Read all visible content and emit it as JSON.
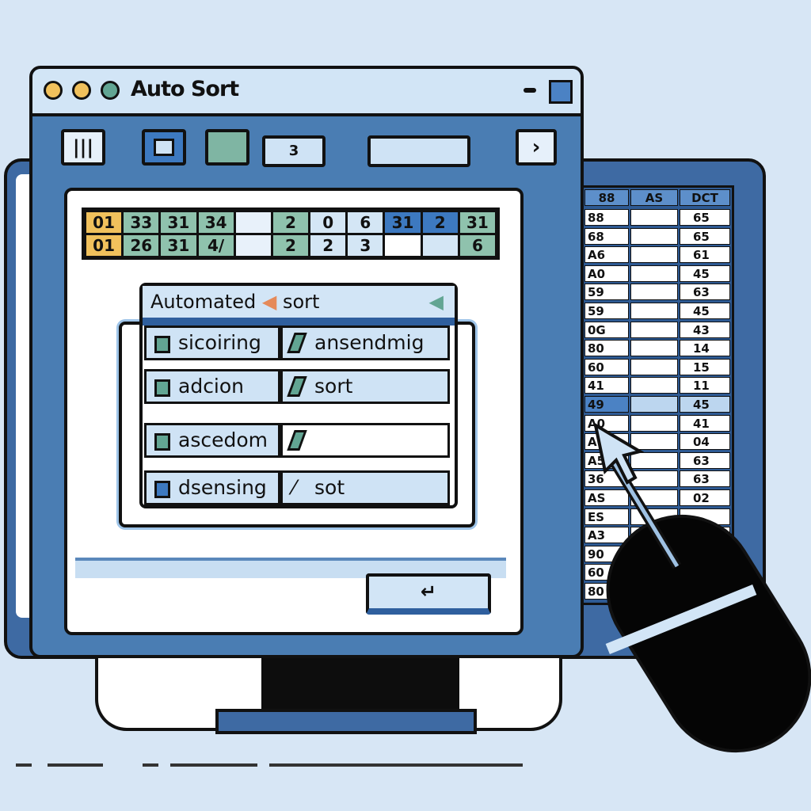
{
  "window": {
    "title": "Auto Sort",
    "toolbar": {
      "field_value": "3"
    }
  },
  "grid": {
    "rows": [
      [
        "01",
        "33",
        "31",
        "34",
        "",
        "2",
        "0",
        "6",
        "31",
        "2",
        "31"
      ],
      [
        "01",
        "26",
        "31",
        "4/",
        "",
        "2",
        "2",
        "3",
        "",
        "",
        "6"
      ]
    ],
    "colors": [
      "#f1c15c",
      "#8fc2ad",
      "#8fc2ad",
      "#8fc2ad",
      "#e8f1fa",
      "#8fc2ad",
      "#d4e6f5",
      "#d4e6f5",
      "#3d79c0",
      "#3d79c0",
      "#8fc2ad"
    ],
    "row2_colors": [
      "#f1c15c",
      "#8fc2ad",
      "#8fc2ad",
      "#8fc2ad",
      "#e8f1fa",
      "#8fc2ad",
      "#d4e6f5",
      "#d4e6f5",
      "#ffffff",
      "#d4e6f5",
      "#8fc2ad"
    ]
  },
  "dialog": {
    "title": "Automated",
    "title_suffix": "sort",
    "options": [
      {
        "label": "sicoiring",
        "value": "ansendmig"
      },
      {
        "label": "adcion",
        "value": "sort"
      },
      {
        "label": "ascedom",
        "value": ""
      },
      {
        "label": "dsensing",
        "value": "sot"
      }
    ],
    "ok_label": "↵"
  },
  "sheet": {
    "headers": [
      "88",
      "AS",
      "DCT"
    ],
    "col_a": [
      "88",
      "68",
      "A6",
      "A0",
      "59",
      "59",
      "0G",
      "80",
      "60",
      "41",
      "49",
      "A0",
      "A",
      "A5",
      "36",
      "AS",
      "ES",
      "A3",
      "90",
      "60",
      "80"
    ],
    "col_c": [
      "65",
      "65",
      "61",
      "45",
      "63",
      "45",
      "43",
      "14",
      "15",
      "11",
      "45",
      "41",
      "04",
      "63",
      "63",
      "02",
      "",
      "",
      "",
      "",
      ""
    ],
    "highlight_row": 10
  },
  "colors": {
    "accent": "#3e6aa3",
    "background": "#d7e6f5"
  }
}
